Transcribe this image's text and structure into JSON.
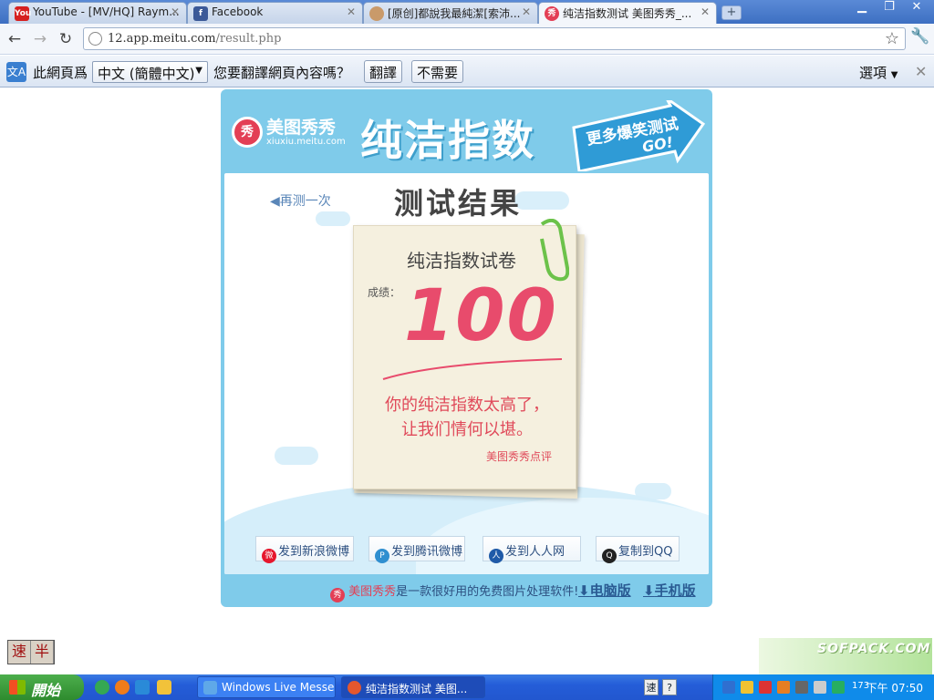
{
  "browser": {
    "tabs": [
      {
        "title": "YouTube - [MV/HQ] Raym...",
        "favicon": "youtube-icon"
      },
      {
        "title": "Facebook",
        "favicon": "facebook-icon"
      },
      {
        "title": "[原创]都說我最純潔[索沛...",
        "favicon": "avatar-icon"
      },
      {
        "title": "纯洁指数测试 美图秀秀_...",
        "favicon": "meitu-icon",
        "active": true
      }
    ],
    "new_tab_label": "+",
    "address": {
      "host": "12.app.meitu.com",
      "path": "/result.php"
    }
  },
  "translate_bar": {
    "label": "此網頁爲",
    "language": "中文 (簡體中文)",
    "question": "您要翻譯網頁內容嗎？",
    "translate_button": "翻譯",
    "decline_button": "不需要",
    "options": "選項",
    "icon_text": "文A"
  },
  "page": {
    "logo_badge": "秀",
    "logo_name": "美图秀秀",
    "logo_domain": "xiuxiu.meitu.com",
    "banner_title": "纯洁指数",
    "more_tests": "更多爆笑测试",
    "go": "GO!",
    "retry": "再测一次",
    "result_title": "测试结果",
    "paper": {
      "title": "纯洁指数试卷",
      "score_label": "成绩：",
      "score": "100",
      "comment_line1": "你的纯洁指数太高了，",
      "comment_line2": "让我们情何以堪。",
      "signature": "美图秀秀点评"
    },
    "share_buttons": [
      {
        "label": "发到新浪微博",
        "icon": "sina-weibo-icon",
        "color": "#e6162d"
      },
      {
        "label": "发到腾讯微博",
        "icon": "tencent-weibo-icon",
        "color": "#2f8fd0"
      },
      {
        "label": "发到人人网",
        "icon": "renren-icon",
        "color": "#1f5aa8"
      },
      {
        "label": "复制到QQ",
        "icon": "qq-icon",
        "color": "#222222"
      }
    ],
    "footer": {
      "badge": "秀",
      "brand": "美图秀秀",
      "text": "是一款很好用的免费图片处理软件!",
      "pc_link": "电脑版",
      "mobile_link": "手机版"
    }
  },
  "ime": {
    "mode1": "速",
    "mode2": "半"
  },
  "watermark": {
    "text": "SOFPACK.COM"
  },
  "taskbar": {
    "start_label": "開始",
    "tasks": [
      {
        "label": "Windows Live Messen...",
        "icon": "messenger-icon"
      },
      {
        "label": "纯洁指数测试 美图...",
        "icon": "chrome-icon",
        "active": true
      }
    ],
    "lang_items": [
      "速",
      "?"
    ],
    "tray_badge": "173",
    "clock": "下午 07:50"
  },
  "colors": {
    "card_blue": "#7fcbea",
    "score_red": "#e84b6c",
    "brand_red": "#e33f55",
    "link_blue": "#2a5b93"
  }
}
